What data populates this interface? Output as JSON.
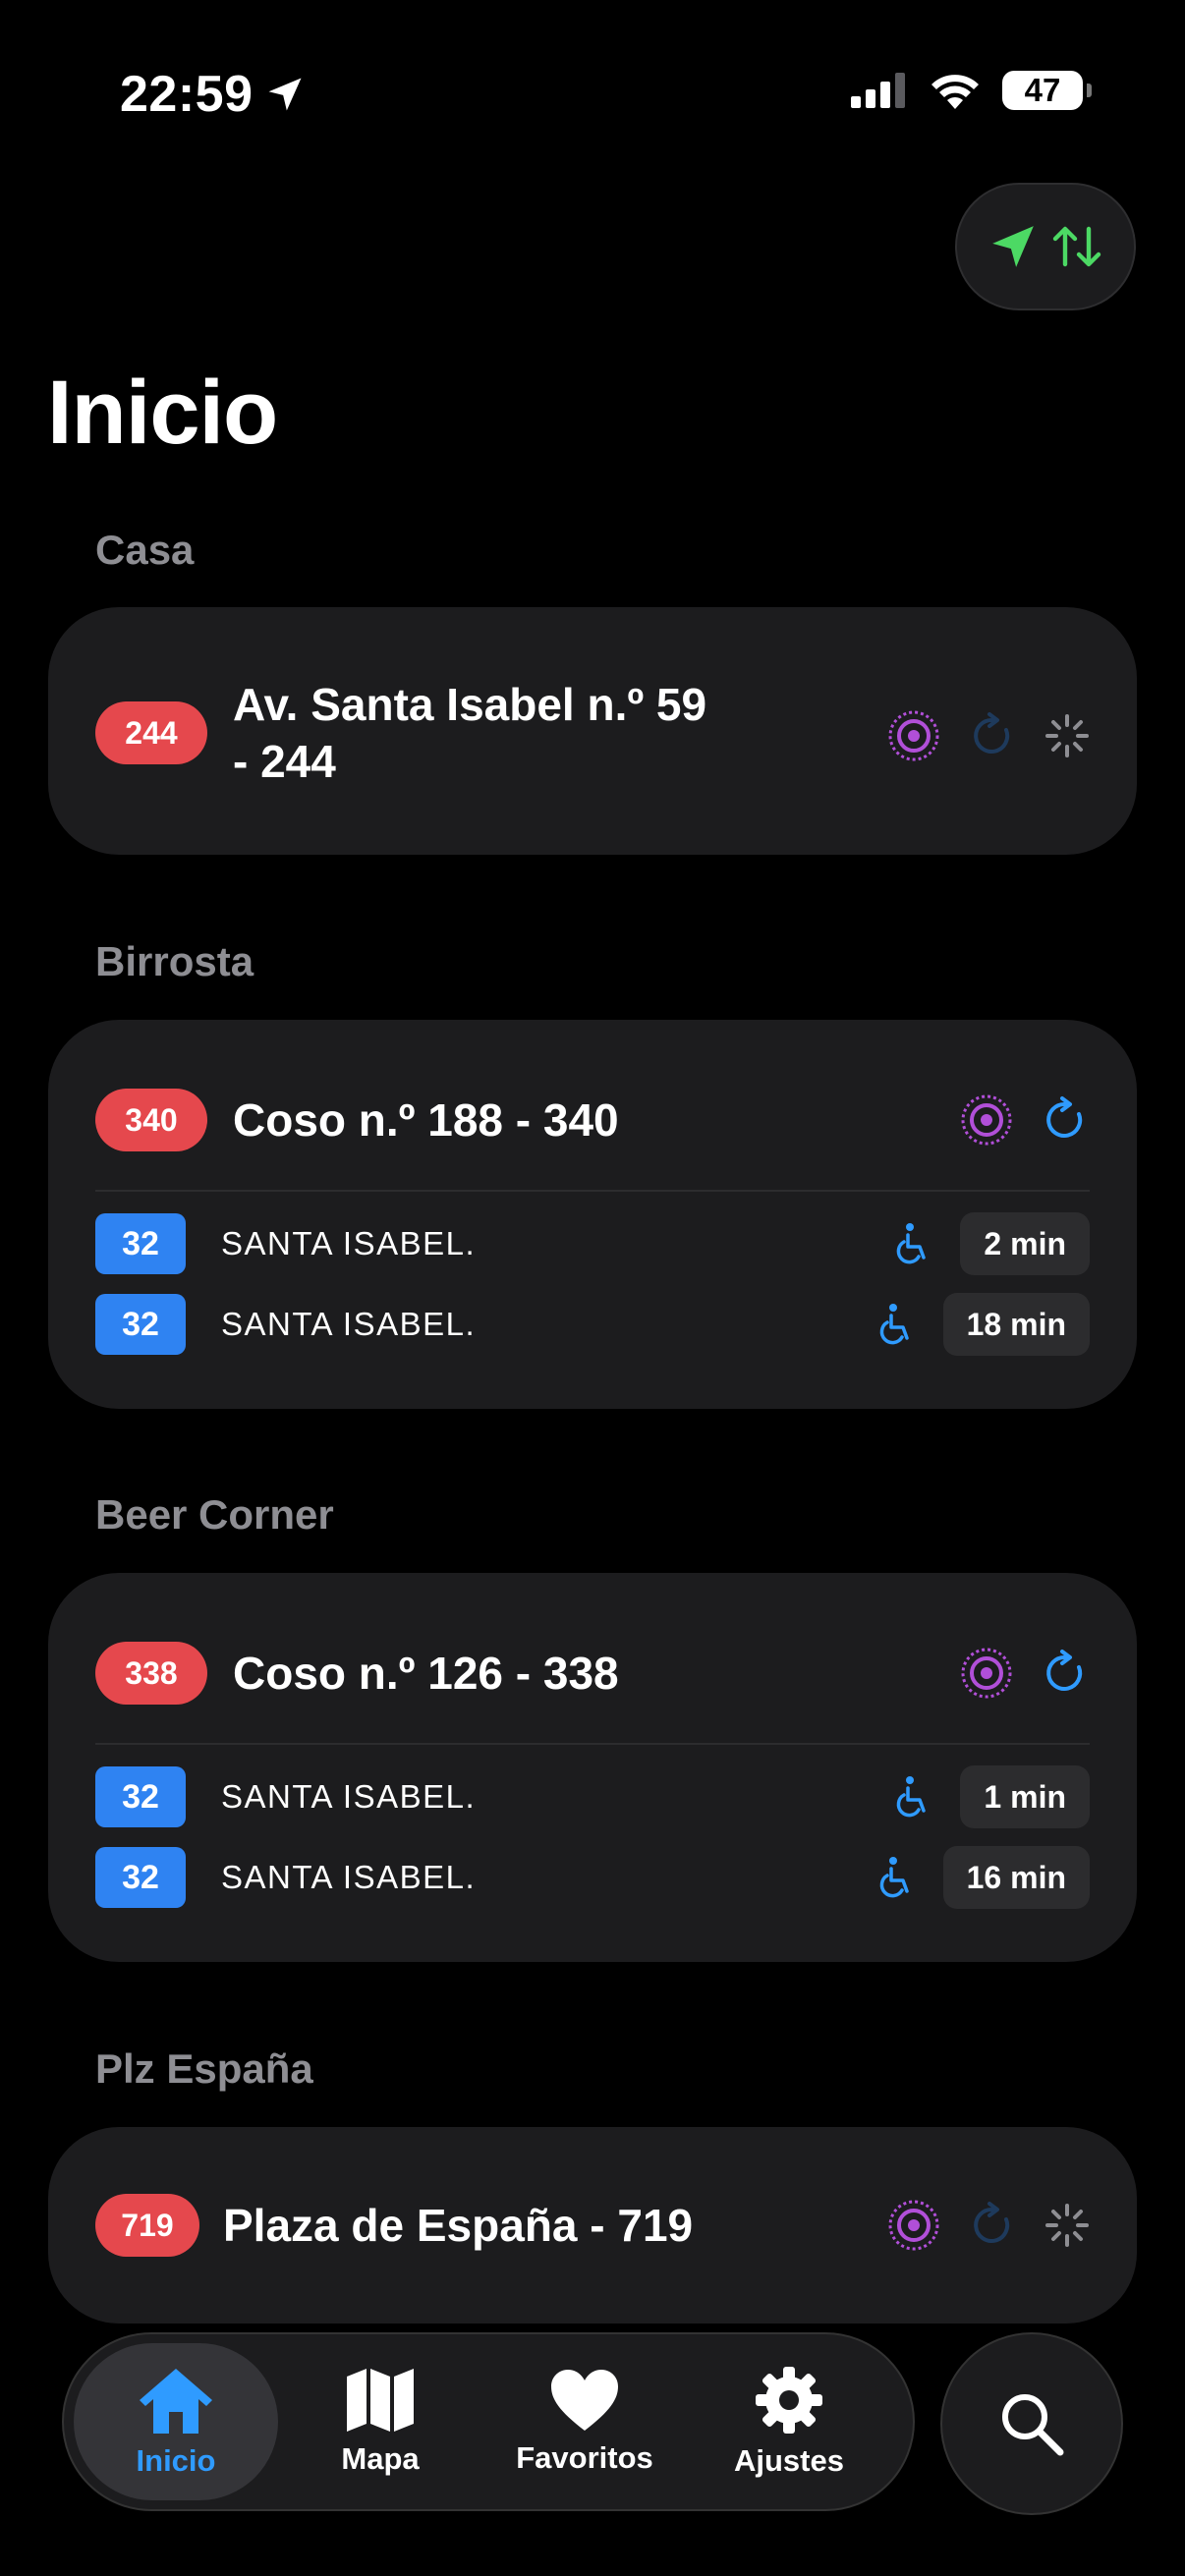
{
  "status_bar": {
    "time": "22:59",
    "battery": "47"
  },
  "page_title": "Inicio",
  "sections": [
    {
      "label": "Casa",
      "stop": {
        "number": "244",
        "name_line1": "Av. Santa Isabel n.º 59",
        "name_line2": "- 244"
      },
      "arrivals": []
    },
    {
      "label": "Birrosta",
      "stop": {
        "number": "340",
        "name": "Coso n.º 188 - 340"
      },
      "arrivals": [
        {
          "line": "32",
          "destination": "SANTA ISABEL.",
          "eta": "2 min"
        },
        {
          "line": "32",
          "destination": "SANTA ISABEL.",
          "eta": "18 min"
        }
      ]
    },
    {
      "label": "Beer Corner",
      "stop": {
        "number": "338",
        "name": "Coso n.º 126 - 338"
      },
      "arrivals": [
        {
          "line": "32",
          "destination": "SANTA ISABEL.",
          "eta": "1 min"
        },
        {
          "line": "32",
          "destination": "SANTA ISABEL.",
          "eta": "16 min"
        }
      ]
    },
    {
      "label": "Plz España",
      "stop": {
        "number": "719",
        "name": "Plaza de España - 719"
      },
      "arrivals": []
    }
  ],
  "tabs": [
    {
      "label": "Inicio",
      "icon": "house-icon",
      "active": true
    },
    {
      "label": "Mapa",
      "icon": "map-icon",
      "active": false
    },
    {
      "label": "Favoritos",
      "icon": "heart-icon",
      "active": false
    },
    {
      "label": "Ajustes",
      "icon": "gear-icon",
      "active": false
    }
  ],
  "colors": {
    "stop_badge": "#e5484d",
    "line_badge": "#2f83f2",
    "accent_blue": "#2f9bff",
    "live_purple": "#b14fd8",
    "location_green": "#4cd964",
    "card_bg": "#1c1c1e"
  }
}
